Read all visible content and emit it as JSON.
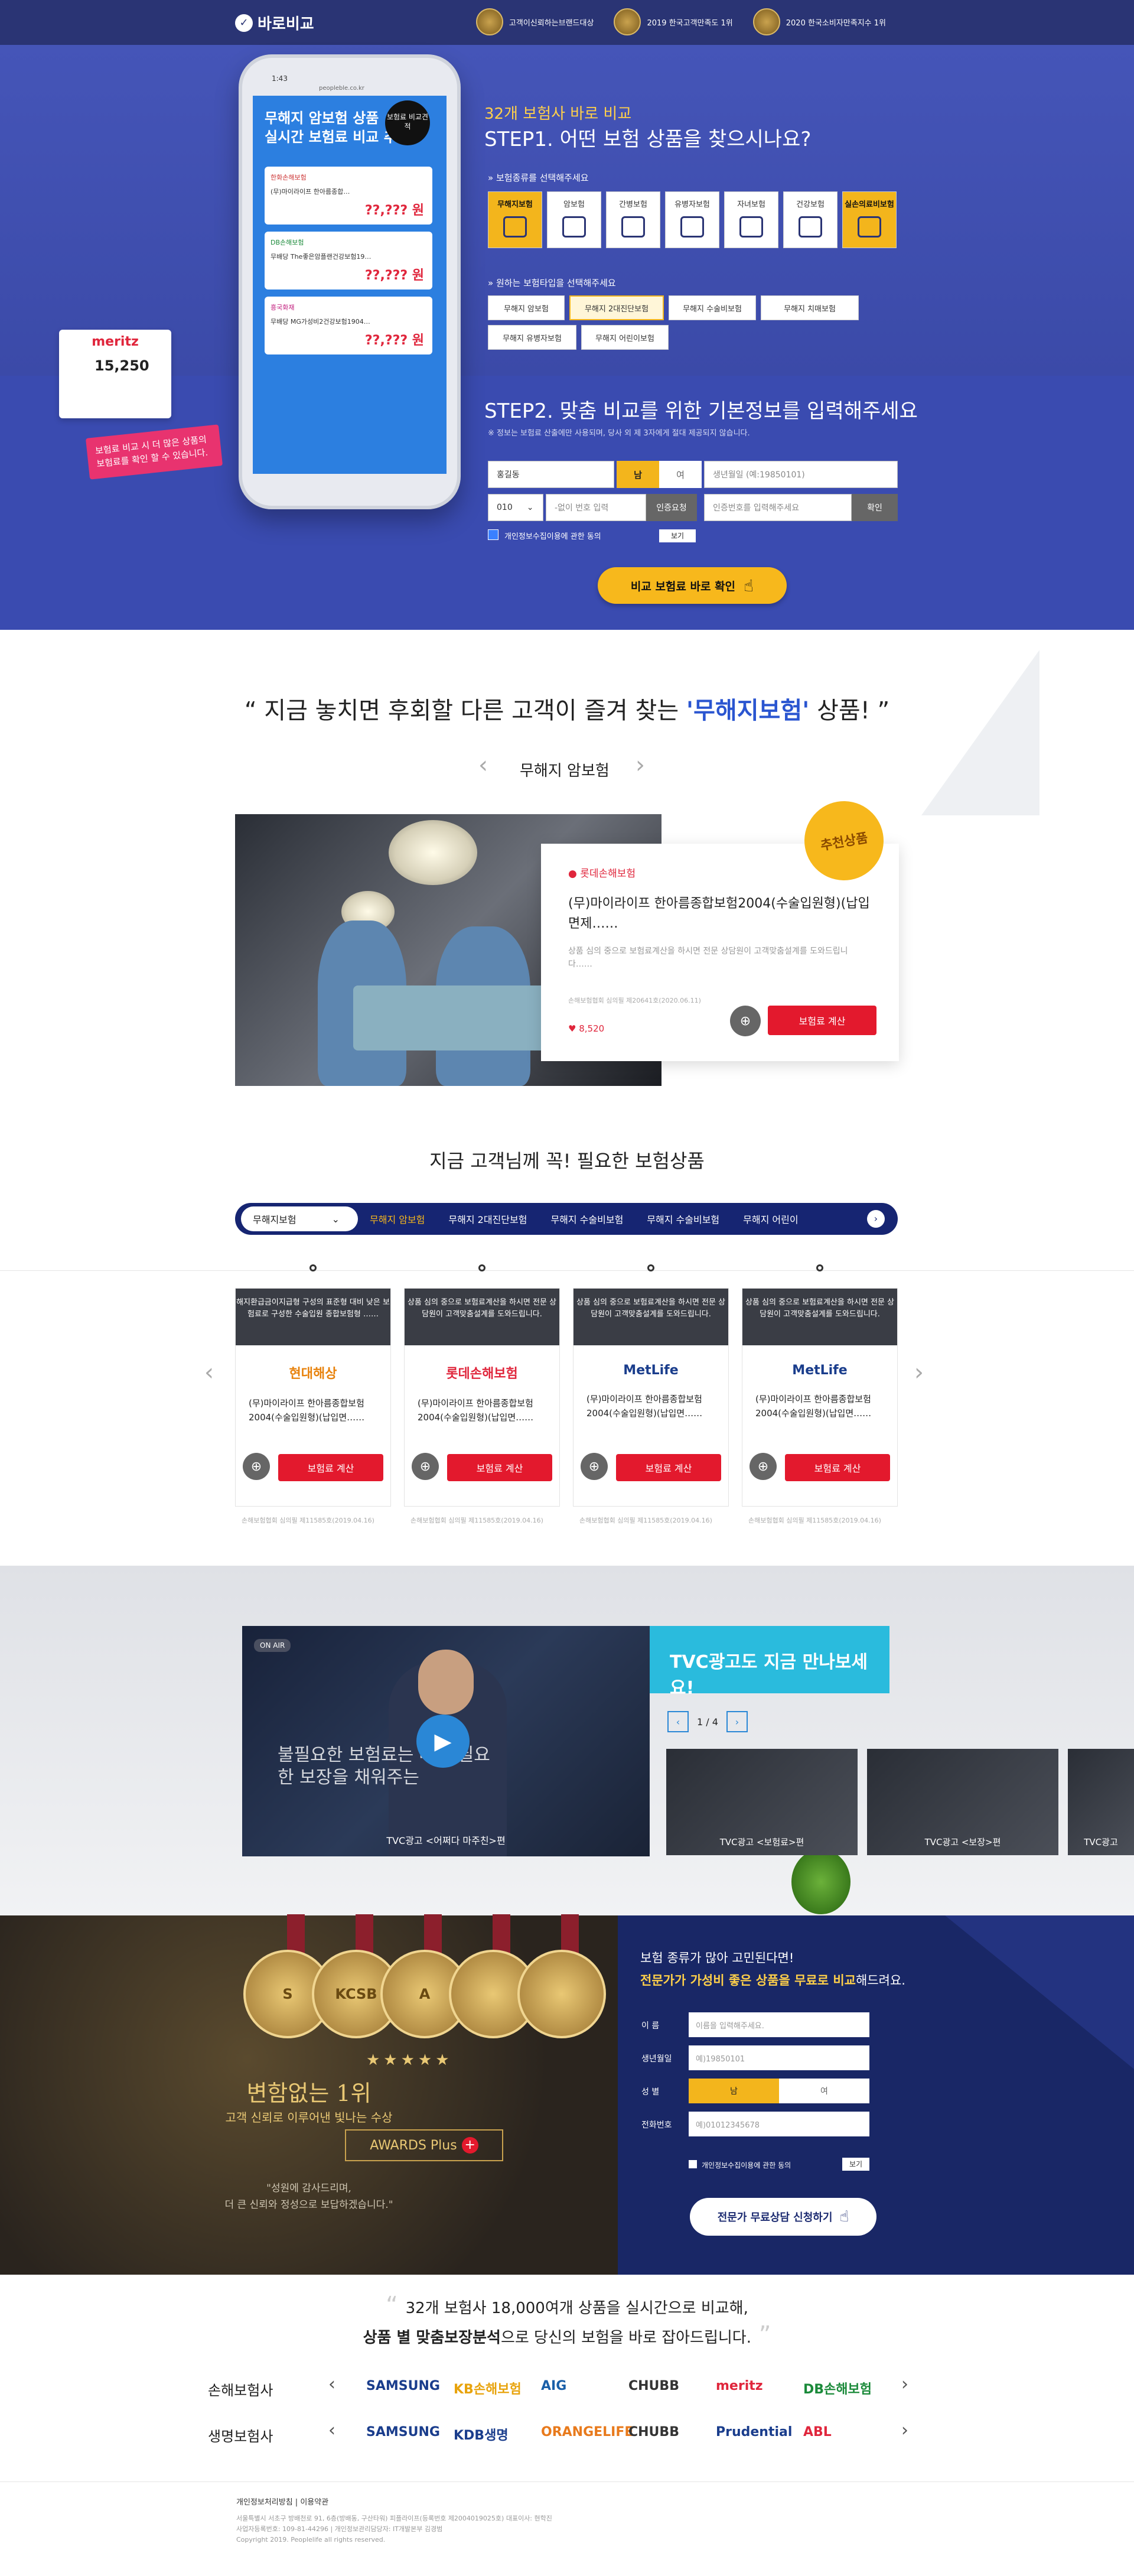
{
  "header": {
    "logo": "바로비교",
    "awards": [
      "고객이신뢰하는브랜드대상",
      "2019 한국고객만족도 1위",
      "2020 한국소비자만족지수 1위"
    ]
  },
  "hero": {
    "phone": {
      "time": "1:43",
      "url": "peopleble.co.kr",
      "title1": "무해지 암보험 상품",
      "title2": "실시간 보험료 비교 추천",
      "badge": "보험료 비교견적",
      "cards": [
        {
          "company": "한화손해보험",
          "name": "(무)마이라이프 한아름종합…",
          "price": "??,??? 원"
        },
        {
          "company": "DB손해보험",
          "name": "무배당 The좋은암플랜건강보험19…",
          "price": "??,??? 원"
        },
        {
          "company": "흥국화재",
          "name": "무배당 MG가성비2건강보험1904…",
          "price": "??,??? 원"
        }
      ],
      "meritz": "meritz",
      "value": "15,250",
      "pink": "보험료 비교 시 더 많은 상품의 보험료를 확인 할 수 있습니다."
    },
    "step1_sub": "32개 보험사 바로 비교",
    "step1_title": "STEP1. 어떤 보험 상품을 찾으시나요?",
    "step1_note": "» 보험종류를 선택해주세요",
    "types": [
      "무해지보험",
      "암보험",
      "간병보험",
      "유병자보험",
      "자녀보험",
      "건강보험",
      "실손의료비보험"
    ],
    "step1_note2": "» 원하는 보험타입을 선택해주세요",
    "subtypes": [
      "무해지 암보험",
      "무해지 2대진단보험",
      "무해지 수술비보험",
      "무해지 치매보험",
      "무해지 유병자보험",
      "무해지 어린이보험"
    ],
    "step2_title": "STEP2. 맞춤 비교를 위한 기본정보를 입력해주세요",
    "step2_note": "※ 정보는 보험료 산출에만 사용되며, 당사 외 제 3자에게 절대 제공되지 않습니다.",
    "name_value": "홍길동",
    "male": "남",
    "female": "여",
    "birth_placeholder": "생년월일 (예:19850101)",
    "phone_prefix": "010",
    "phone_placeholder": "-없이 번호 입력",
    "auth_btn": "인증요청",
    "code_placeholder": "인증번호를 입력해주세요",
    "confirm_btn": "확인",
    "agree": "개인정보수집이용에 관한 동의",
    "agree_view": "보기",
    "cta": "비교 보험료 바로 확인"
  },
  "featured": {
    "title_pre": "지금 놓치면 후회할 다른 고객이 즐겨 찾는 ",
    "title_hl": "'무해지보험'",
    "title_post": " 상품!",
    "nav_label": "무해지 암보험",
    "badge": "추천상품",
    "company": "롯데손해보험",
    "product": "(무)마이라이프 한아름종합보험2004(수술입원형)(납입면제……",
    "desc": "상품 심의 중으로 보험료계산을 하시면 전문 상담원이 고객맞춤설계를 도와드립니다……",
    "license": "손해보험협회 심의필 제20641호(2020.06.11)",
    "likes": "8,520",
    "btn": "보험료 계산"
  },
  "needed": {
    "title": "지금 고객님께 꼭! 필요한 보험상품",
    "select": "무해지보험",
    "tabs": [
      "무해지 암보험",
      "무해지 2대진단보험",
      "무해지 수술비보험",
      "무해지 수술비보험",
      "무해지 어린이"
    ],
    "cards": [
      {
        "hd": "해지환급금이지급형 구성의 표준형 대비 낮은 보험료로 구성한 수술입원 종합보험형 ……",
        "logo": "현대해상",
        "name": "(무)마이라이프 한아름종합보험2004(수술입원형)(납입면……",
        "btn": "보험료 계산",
        "lic": "손해보험협회 심의필 제11585호(2019.04.16)"
      },
      {
        "hd": "상품 심의 중으로 보험료계산을 하시면 전문 상담원이 고객맞춤설계를 도와드립니다.",
        "logo": "롯데손해보험",
        "name": "(무)마이라이프 한아름종합보험2004(수술입원형)(납입면……",
        "btn": "보험료 계산",
        "lic": "손해보험협회 심의필 제11585호(2019.04.16)"
      },
      {
        "hd": "상품 심의 중으로 보험료계산을 하시면 전문 상담원이 고객맞춤설계를 도와드립니다.",
        "logo": "MetLife",
        "name": "(무)마이라이프 한아름종합보험2004(수술입원형)(납입면……",
        "btn": "보험료 계산",
        "lic": "손해보험협회 심의필 제11585호(2019.04.16)"
      },
      {
        "hd": "상품 심의 중으로 보험료계산을 하시면 전문 상담원이 고객맞춤설계를 도와드립니다.",
        "logo": "MetLife",
        "name": "(무)마이라이프 한아름종합보험2004(수술입원형)(납입면……",
        "btn": "보험료 계산",
        "lic": "손해보험협회 심의필 제11585호(2019.04.16)"
      }
    ]
  },
  "tvc": {
    "onair": "ON AIR",
    "main_caption": "TVC광고 <어쩌다 마주친>편",
    "video_text": "불필요한 보험료는 빼고 필요한 보장을 채워주는",
    "title_hl": "TVC광고",
    "title": "도 지금 만나보세요!",
    "page": "1 / 4",
    "thumbs": [
      "TVC광고 <보험료>편",
      "TVC광고 <보장>편",
      "TVC광고"
    ]
  },
  "award": {
    "medals": [
      "S",
      "KCSB",
      "A",
      "",
      "",
      ""
    ],
    "stars": "★★★★★",
    "t1": "변함없는 1위",
    "t2": "고객 신뢰로 이루어낸 빛나는 수상",
    "plus": "AWARDS Plus",
    "q1": "\"성원에 감사드리며,",
    "q2": "더 큰 신뢰와 정성으로 보답하겠습니다.\""
  },
  "consult": {
    "h1": "보험 종류가 많아 고민된다면!",
    "h2a": "전문가가 가성비 좋은 상품을 무료로 비교",
    "h2b": "해드려요.",
    "labels": [
      "이 름",
      "생년월일",
      "성 별",
      "전화번호"
    ],
    "name_ph": "이름을 입력해주세요.",
    "birth_ph": "예)19850101",
    "male": "남",
    "female": "여",
    "phone_ph": "예)01012345678",
    "agree": "개인정보수집이용에 관한 동의",
    "view": "보기",
    "cta": "전문가 무료상담 신청하기"
  },
  "partners": {
    "q1": "32개 보험사 18,000여개 상품을 실시간으로 비교해,",
    "q2b": "상품 별 맞춤보장분석",
    "q2": "으로 당신의 보험을 바로 잡아드립니다.",
    "row1_label": "손해보험사",
    "row1": [
      "SAMSUNG",
      "KB손해보험",
      "AIG",
      "CHUBB",
      "meritz",
      "DB손해보험"
    ],
    "row2_label": "생명보험사",
    "row2": [
      "SAMSUNG",
      "KDB생명",
      "ORANGELIFE",
      "CHUBB",
      "Prudential",
      "ABL"
    ]
  },
  "footer": {
    "links": "개인정보처리방침   |   이용약관",
    "addr1": "서울특별시 서초구 방배천로 91, 6층(방배동, 구산타워) 피플라이프(등록번호 제2004019025호)   대표이사: 현학진",
    "addr2": "사업자등록번호: 109-81-44296   |   개인정보관리담당자: IT개발본부 김경범",
    "copy": "Copyright 2019. Peoplelife all rights reserved."
  }
}
